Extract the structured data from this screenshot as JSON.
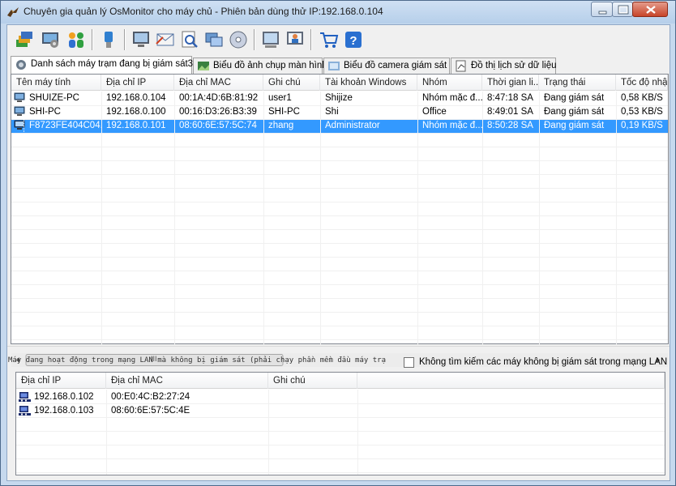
{
  "window": {
    "title": "Chuyên gia quản lý OsMonitor cho máy chủ - Phiên bản dùng thử IP:192.168.0.104"
  },
  "toolbar": {
    "icons": [
      "layers-icon",
      "screen-settings-icon",
      "users-group-icon",
      "usb-key-icon",
      "monitor-icon",
      "mail-icon",
      "search-document-icon",
      "windows-icon",
      "disc-icon",
      "screenshot-icon",
      "user-monitor-icon",
      "shopping-cart-icon",
      "help-icon"
    ]
  },
  "tabs": [
    {
      "label": "Danh sách máy trạm đang bị giám sát3",
      "icon": "computers-tab-icon"
    },
    {
      "label": "Biểu đồ ảnh chụp màn hình",
      "icon": "image-tab-icon"
    },
    {
      "label": "Biểu đồ camera giám sát",
      "icon": "camera-tab-icon"
    },
    {
      "label": "Đồ thị lịch sử dữ liệu",
      "icon": "history-tab-icon"
    }
  ],
  "monitored": {
    "columns": [
      "Tên máy tính",
      "Địa chỉ IP",
      "Địa chỉ MAC",
      "Ghi chú",
      "Tài khoản Windows",
      "Nhóm",
      "Thời gian li...",
      "Trạng thái",
      "Tốc độ nhậ..."
    ],
    "rows": [
      {
        "cells": [
          "SHUIZE-PC",
          "192.168.0.104",
          "00:1A:4D:6B:81:92",
          "user1",
          "Shijize",
          "Nhóm mặc đ...",
          "8:47:18 SA",
          "Đang giám sát",
          "0,58 KB/S"
        ],
        "selected": false
      },
      {
        "cells": [
          "SHI-PC",
          "192.168.0.100",
          "00:16:D3:26:B3:39",
          "SHI-PC",
          "Shi",
          "Office",
          "8:49:01 SA",
          "Đang giám sát",
          "0,53 KB/S"
        ],
        "selected": false
      },
      {
        "cells": [
          "F8723FE404C04...",
          "192.168.0.101",
          "08:60:6E:57:5C:74",
          "zhang",
          "Administrator",
          "Nhóm mặc đ...",
          "8:50:28 SA",
          "Đang giám sát",
          "0,19 KB/S"
        ],
        "selected": true
      }
    ],
    "scroll_thumb_label": "III"
  },
  "unmonitored": {
    "label": "Máy đang hoạt động trong mạng LAN mà không bị giám sát (phải chạy phần mềm đầu máy trạ",
    "checkbox_label": "Không tìm kiếm các máy không bị giám sát trong mạng LAN",
    "columns": [
      "Địa chỉ IP",
      "Địa chỉ MAC",
      "Ghi chú"
    ],
    "rows": [
      {
        "cells": [
          "192.168.0.102",
          "00:E0:4C:B2:27:24",
          ""
        ]
      },
      {
        "cells": [
          "192.168.0.103",
          "08:60:6E:57:5C:4E",
          ""
        ]
      }
    ]
  },
  "colors": {
    "selection": "#3399ff",
    "title_bar": "#b6cfea",
    "close_button": "#c7452a"
  }
}
